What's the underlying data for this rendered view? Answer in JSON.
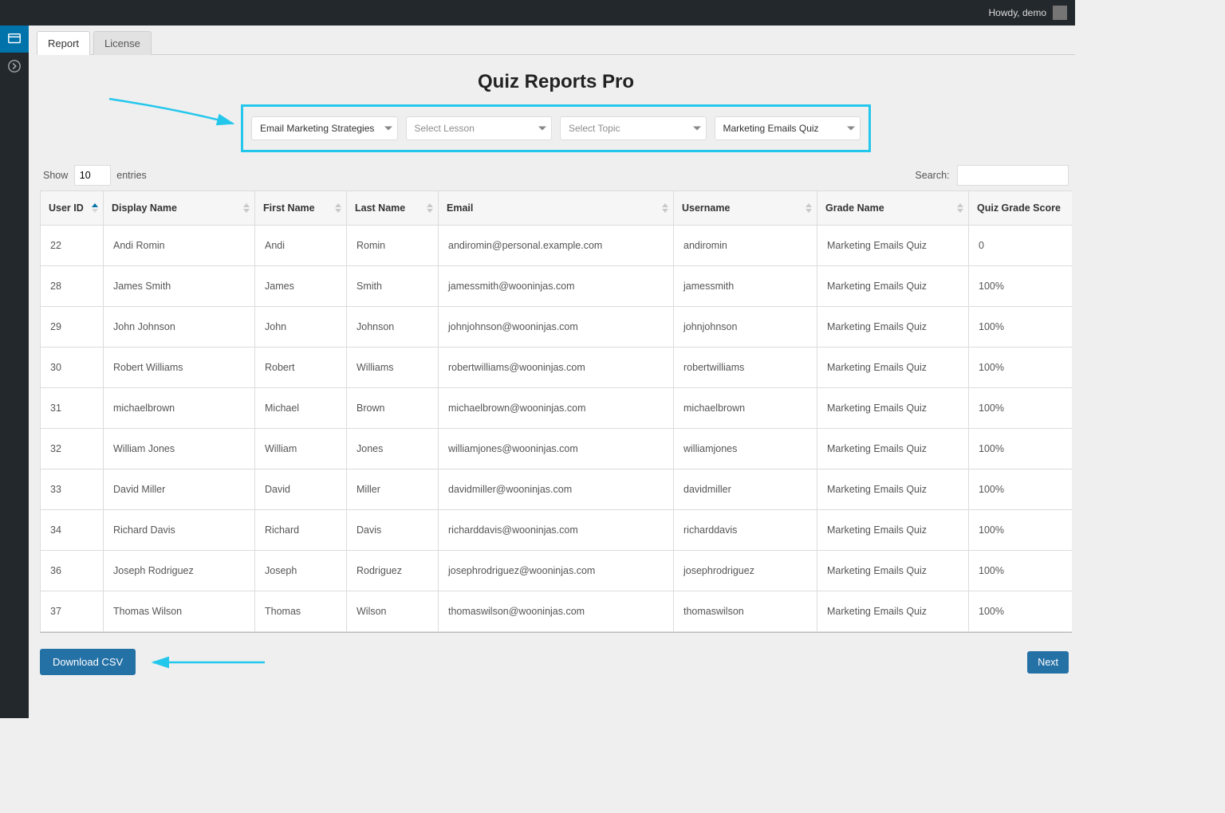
{
  "adminbar": {
    "howdy": "Howdy, demo"
  },
  "tabs": {
    "report": "Report",
    "license": "License"
  },
  "page_title": "Quiz Reports Pro",
  "filters": {
    "course_value": "Email Marketing Strategies",
    "lesson_placeholder": "Select Lesson",
    "topic_placeholder": "Select Topic",
    "quiz_value": "Marketing Emails Quiz"
  },
  "datatable": {
    "show_label_pre": "Show",
    "show_value": "10",
    "show_label_post": "entries",
    "search_label": "Search:",
    "search_value": ""
  },
  "columns": {
    "user_id": "User ID",
    "display_name": "Display Name",
    "first_name": "First Name",
    "last_name": "Last Name",
    "email": "Email",
    "username": "Username",
    "grade_name": "Grade Name",
    "quiz_grade_score": "Quiz Grade Score"
  },
  "rows": [
    {
      "uid": "22",
      "display": "Andi Romin",
      "first": "Andi",
      "last": "Romin",
      "email": "andiromin@personal.example.com",
      "user": "andiromin",
      "grade": "Marketing Emails Quiz",
      "score": "0"
    },
    {
      "uid": "28",
      "display": "James Smith",
      "first": "James",
      "last": "Smith",
      "email": "jamessmith@wooninjas.com",
      "user": "jamessmith",
      "grade": "Marketing Emails Quiz",
      "score": "100%"
    },
    {
      "uid": "29",
      "display": "John Johnson",
      "first": "John",
      "last": "Johnson",
      "email": "johnjohnson@wooninjas.com",
      "user": "johnjohnson",
      "grade": "Marketing Emails Quiz",
      "score": "100%"
    },
    {
      "uid": "30",
      "display": "Robert Williams",
      "first": "Robert",
      "last": "Williams",
      "email": "robertwilliams@wooninjas.com",
      "user": "robertwilliams",
      "grade": "Marketing Emails Quiz",
      "score": "100%"
    },
    {
      "uid": "31",
      "display": "michaelbrown",
      "first": "Michael",
      "last": "Brown",
      "email": "michaelbrown@wooninjas.com",
      "user": "michaelbrown",
      "grade": "Marketing Emails Quiz",
      "score": "100%"
    },
    {
      "uid": "32",
      "display": "William Jones",
      "first": "William",
      "last": "Jones",
      "email": "williamjones@wooninjas.com",
      "user": "williamjones",
      "grade": "Marketing Emails Quiz",
      "score": "100%"
    },
    {
      "uid": "33",
      "display": "David Miller",
      "first": "David",
      "last": "Miller",
      "email": "davidmiller@wooninjas.com",
      "user": "davidmiller",
      "grade": "Marketing Emails Quiz",
      "score": "100%"
    },
    {
      "uid": "34",
      "display": "Richard Davis",
      "first": "Richard",
      "last": "Davis",
      "email": "richarddavis@wooninjas.com",
      "user": "richarddavis",
      "grade": "Marketing Emails Quiz",
      "score": "100%"
    },
    {
      "uid": "36",
      "display": "Joseph Rodriguez",
      "first": "Joseph",
      "last": "Rodriguez",
      "email": "josephrodriguez@wooninjas.com",
      "user": "josephrodriguez",
      "grade": "Marketing Emails Quiz",
      "score": "100%"
    },
    {
      "uid": "37",
      "display": "Thomas Wilson",
      "first": "Thomas",
      "last": "Wilson",
      "email": "thomaswilson@wooninjas.com",
      "user": "thomaswilson",
      "grade": "Marketing Emails Quiz",
      "score": "100%"
    }
  ],
  "buttons": {
    "download_csv": "Download CSV",
    "next": "Next"
  },
  "colors": {
    "highlight": "#24c7ec",
    "primary": "#2471a6"
  },
  "icons": {
    "collapse_menu": "collapse-menu-icon",
    "chevron_right": "chevron-right-icon"
  }
}
